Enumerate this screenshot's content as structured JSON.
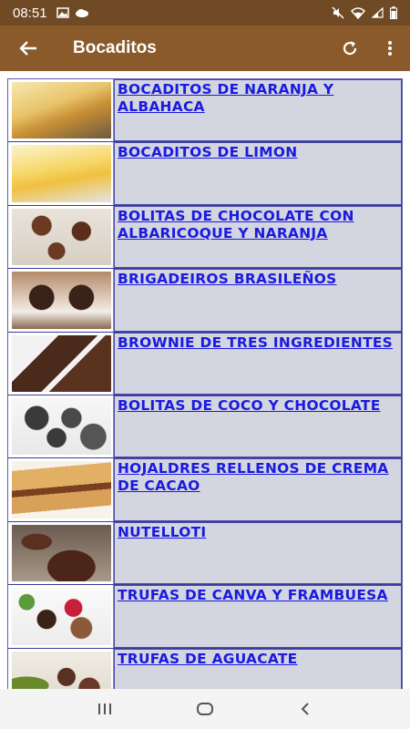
{
  "status_bar": {
    "time": "08:51"
  },
  "app_bar": {
    "title": "Bocaditos"
  },
  "colors": {
    "appbar": "#8a5a2b",
    "statusbar": "#6f4a24",
    "cell_bg": "#d3d5e0",
    "link": "#1a1ae0"
  },
  "recipes": [
    {
      "label": "BOCADITOS DE NARANJA Y ALBAHACA",
      "thumb": "orange-basil-bites-image"
    },
    {
      "label": "BOCADITOS DE LIMON",
      "thumb": "lemon-bites-image"
    },
    {
      "label": "BOLITAS DE CHOCOLATE CON ALBARICOQUE Y NARANJA",
      "thumb": "chocolate-balls-image"
    },
    {
      "label": "BRIGADEIROS BRASILEÑOS",
      "thumb": "brigadeiros-image"
    },
    {
      "label": "BROWNIE DE TRES INGREDIENTES",
      "thumb": "brownie-image"
    },
    {
      "label": "BOLITAS DE COCO Y CHOCOLATE",
      "thumb": "coconut-chocolate-balls-image"
    },
    {
      "label": "HOJALDRES RELLENOS DE CREMA DE CACAO",
      "thumb": "puff-pastry-image"
    },
    {
      "label": "NUTELLOTI",
      "thumb": "nutelloti-image"
    },
    {
      "label": "TRUFAS DE CANVA Y FRAMBUESA",
      "thumb": "raspberry-truffles-image"
    },
    {
      "label": "TRUFAS DE AGUACATE",
      "thumb": "avocado-truffles-image"
    }
  ]
}
